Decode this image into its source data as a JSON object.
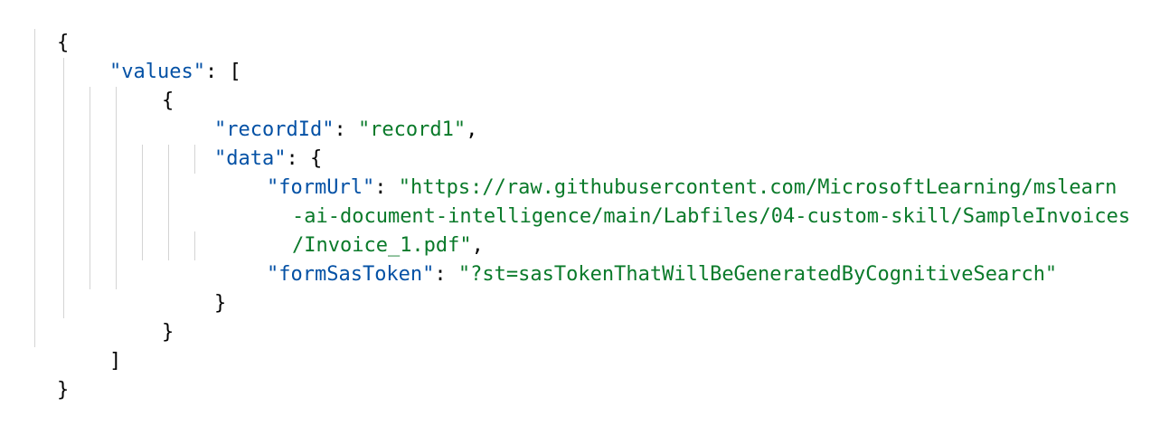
{
  "colors": {
    "key": "#0451a5",
    "string": "#0a7a2a",
    "punctuation": "#000000",
    "indent_guide": "#d4d4d4"
  },
  "code": {
    "open_root": "{",
    "values_key": "\"values\"",
    "values_sep": ": [",
    "open_record": "{",
    "recordId_key": "\"recordId\"",
    "recordId_sep": ": ",
    "recordId_value": "\"record1\"",
    "recordId_comma": ",",
    "data_key": "\"data\"",
    "data_sep": ": {",
    "formUrl_key": "\"formUrl\"",
    "formUrl_sep": ": ",
    "formUrl_value_line1": "\"https://raw.githubusercontent.com/MicrosoftLearning/mslearn",
    "formUrl_value_line2": "-ai-document-intelligence/main/Labfiles/04-custom-skill/SampleInvoices",
    "formUrl_value_line3": "/Invoice_1.pdf\"",
    "formUrl_comma": ",",
    "formSasToken_key": "\"formSasToken\"",
    "formSasToken_sep": ": ",
    "formSasToken_value": "\"?st=sasTokenThatWillBeGeneratedByCognitiveSearch\"",
    "close_data": "}",
    "close_record": "}",
    "close_values": "]",
    "close_root": "}"
  }
}
